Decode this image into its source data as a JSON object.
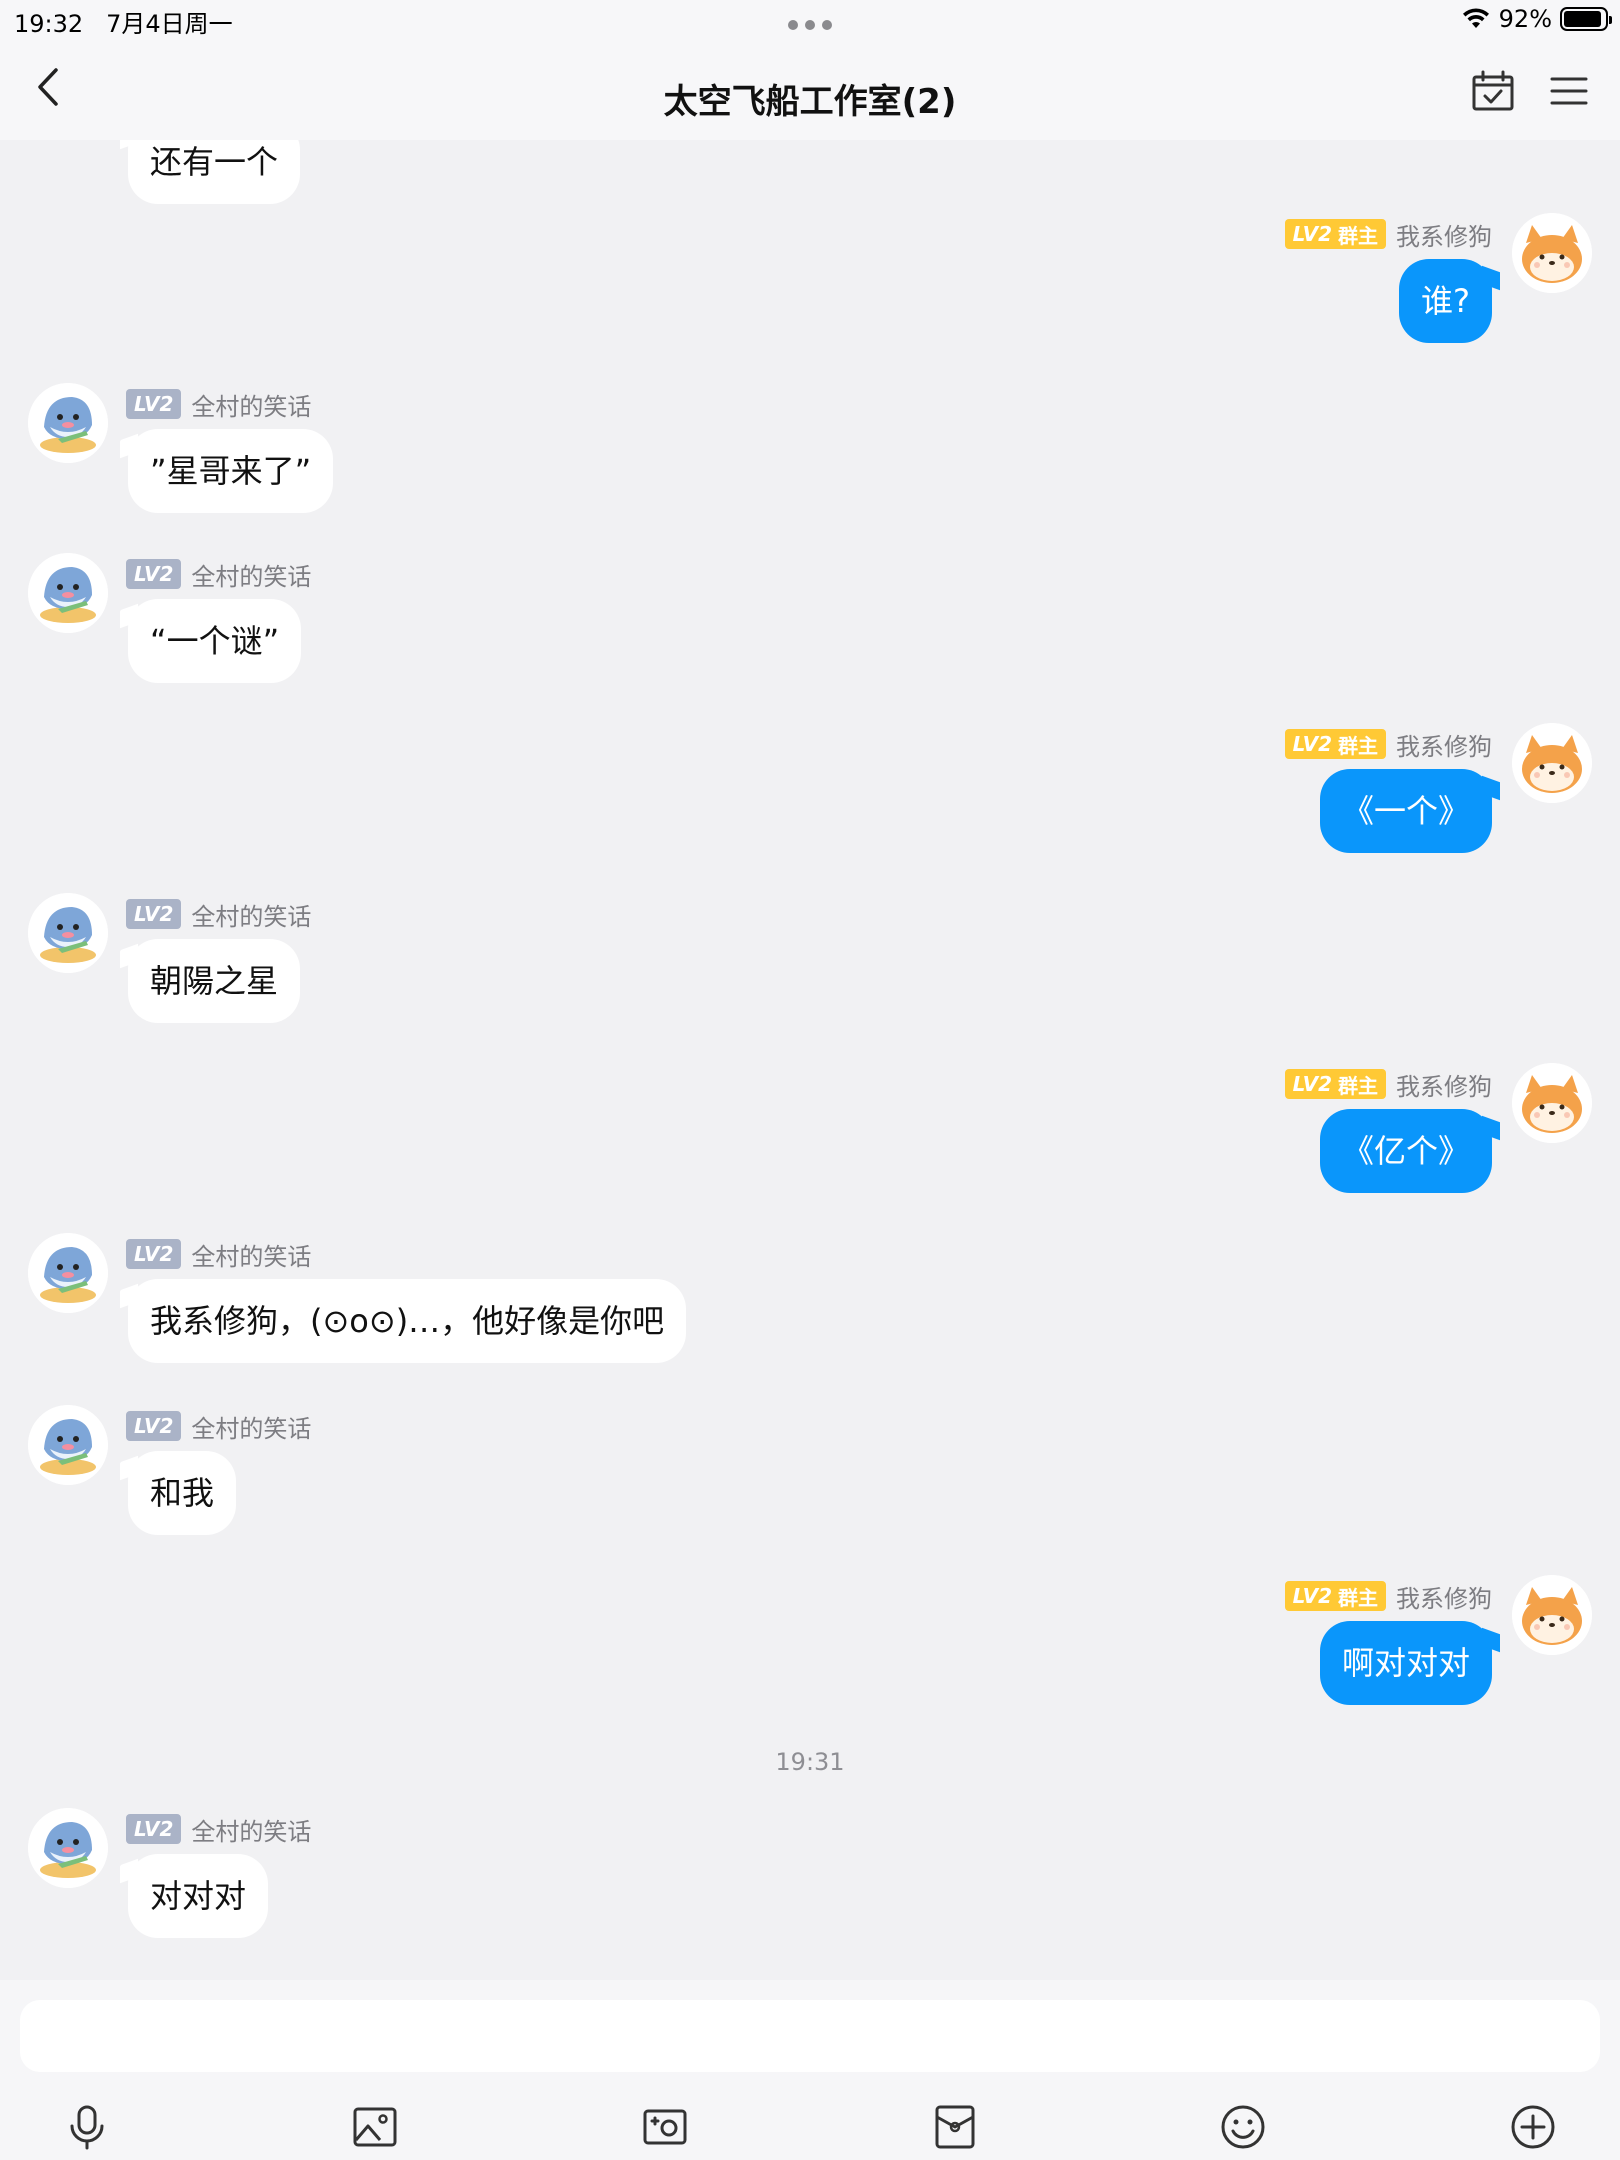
{
  "status_bar": {
    "time": "19:32",
    "date": "7月4日周一",
    "battery_pct": "92%",
    "battery_level": 0.92
  },
  "nav": {
    "title": "太空飞船工作室(2)"
  },
  "colors": {
    "bubble_self": "#0a96fb",
    "bubble_other": "#ffffff",
    "badge_owner": "#ffc935",
    "badge_member": "#aab3c7",
    "background": "#f1f1f3"
  },
  "messages": [
    {
      "side": "left",
      "text": "还有一个",
      "partial": true
    },
    {
      "side": "right",
      "lv": "LV2",
      "role": "群主",
      "sender": "我系修狗",
      "text": "谁?"
    },
    {
      "side": "left",
      "lv": "LV2",
      "sender": "全村的笑话",
      "text": "”星哥来了”"
    },
    {
      "side": "left",
      "lv": "LV2",
      "sender": "全村的笑话",
      "text": "“一个谜”"
    },
    {
      "side": "right",
      "lv": "LV2",
      "role": "群主",
      "sender": "我系修狗",
      "text": "《一个》"
    },
    {
      "side": "left",
      "lv": "LV2",
      "sender": "全村的笑话",
      "text": "朝陽之星"
    },
    {
      "side": "right",
      "lv": "LV2",
      "role": "群主",
      "sender": "我系修狗",
      "text": "《亿个》"
    },
    {
      "side": "left",
      "lv": "LV2",
      "sender": "全村的笑话",
      "text": "我系修狗，(⊙o⊙)…，他好像是你吧"
    },
    {
      "side": "left",
      "lv": "LV2",
      "sender": "全村的笑话",
      "text": "和我"
    },
    {
      "side": "right",
      "lv": "LV2",
      "role": "群主",
      "sender": "我系修狗",
      "text": "啊对对对"
    },
    {
      "side": "left",
      "lv": "LV2",
      "sender": "全村的笑话",
      "text": "对对对"
    }
  ],
  "time_divider": "19:31",
  "input": {
    "placeholder": ""
  },
  "toolbar": {
    "icons": [
      "microphone-icon",
      "image-icon",
      "camera-icon",
      "red-envelope-icon",
      "emoji-icon",
      "plus-icon"
    ]
  }
}
